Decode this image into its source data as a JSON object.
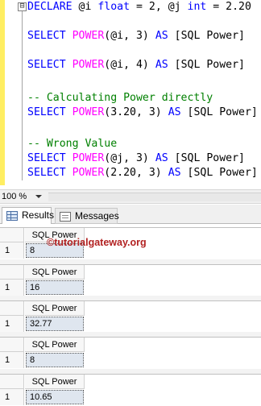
{
  "editor": {
    "lines": [
      {
        "parts": [
          {
            "t": "DECLARE ",
            "c": "kw"
          },
          {
            "t": "@i ",
            "c": "var"
          },
          {
            "t": "float",
            "c": "kw"
          },
          {
            "t": " = 2, @j ",
            "c": "var"
          },
          {
            "t": "int",
            "c": "kw"
          },
          {
            "t": " = 2.20",
            "c": "var"
          }
        ]
      },
      {
        "parts": [
          {
            "t": "SELECT ",
            "c": "kw"
          },
          {
            "t": "POWER",
            "c": "fn"
          },
          {
            "t": "(@i, 3) ",
            "c": "var"
          },
          {
            "t": "AS",
            "c": "kw"
          },
          {
            "t": " [SQL Power]",
            "c": "var"
          }
        ]
      },
      {
        "parts": [
          {
            "t": "SELECT ",
            "c": "kw"
          },
          {
            "t": "POWER",
            "c": "fn"
          },
          {
            "t": "(@i, 4) ",
            "c": "var"
          },
          {
            "t": "AS",
            "c": "kw"
          },
          {
            "t": " [SQL Power]",
            "c": "var"
          }
        ]
      },
      {
        "parts": [
          {
            "t": "-- Calculating Power directly",
            "c": "cm"
          }
        ]
      },
      {
        "parts": [
          {
            "t": "SELECT ",
            "c": "kw"
          },
          {
            "t": "POWER",
            "c": "fn"
          },
          {
            "t": "(3.20, 3) ",
            "c": "var"
          },
          {
            "t": "AS",
            "c": "kw"
          },
          {
            "t": " [SQL Power]",
            "c": "var"
          }
        ]
      },
      {
        "parts": [
          {
            "t": "-- Wrong Value",
            "c": "cm"
          }
        ]
      },
      {
        "parts": [
          {
            "t": "SELECT ",
            "c": "kw"
          },
          {
            "t": "POWER",
            "c": "fn"
          },
          {
            "t": "(@j, 3) ",
            "c": "var"
          },
          {
            "t": "AS",
            "c": "kw"
          },
          {
            "t": " [SQL Power]",
            "c": "var"
          }
        ]
      },
      {
        "parts": [
          {
            "t": "SELECT ",
            "c": "kw"
          },
          {
            "t": "POWER",
            "c": "fn"
          },
          {
            "t": "(2.20, 3) ",
            "c": "var"
          },
          {
            "t": "AS",
            "c": "kw"
          },
          {
            "t": " [SQL Power]",
            "c": "var"
          }
        ]
      }
    ],
    "fold_symbol": "⊟"
  },
  "zoom": {
    "value": "100 %"
  },
  "tabs": {
    "results": "Results",
    "messages": "Messages"
  },
  "results": [
    {
      "column": "SQL Power",
      "row_number": "1",
      "value": "8"
    },
    {
      "column": "SQL Power",
      "row_number": "1",
      "value": "16"
    },
    {
      "column": "SQL Power",
      "row_number": "1",
      "value": "32.77"
    },
    {
      "column": "SQL Power",
      "row_number": "1",
      "value": "8"
    },
    {
      "column": "SQL Power",
      "row_number": "1",
      "value": "10.65"
    }
  ],
  "watermark": "©tutorialgateway.org",
  "colors": {
    "keyword": "#0000ff",
    "function": "#ff00ff",
    "comment": "#008000",
    "change_bar": "#ffee62",
    "watermark": "#b22222"
  }
}
